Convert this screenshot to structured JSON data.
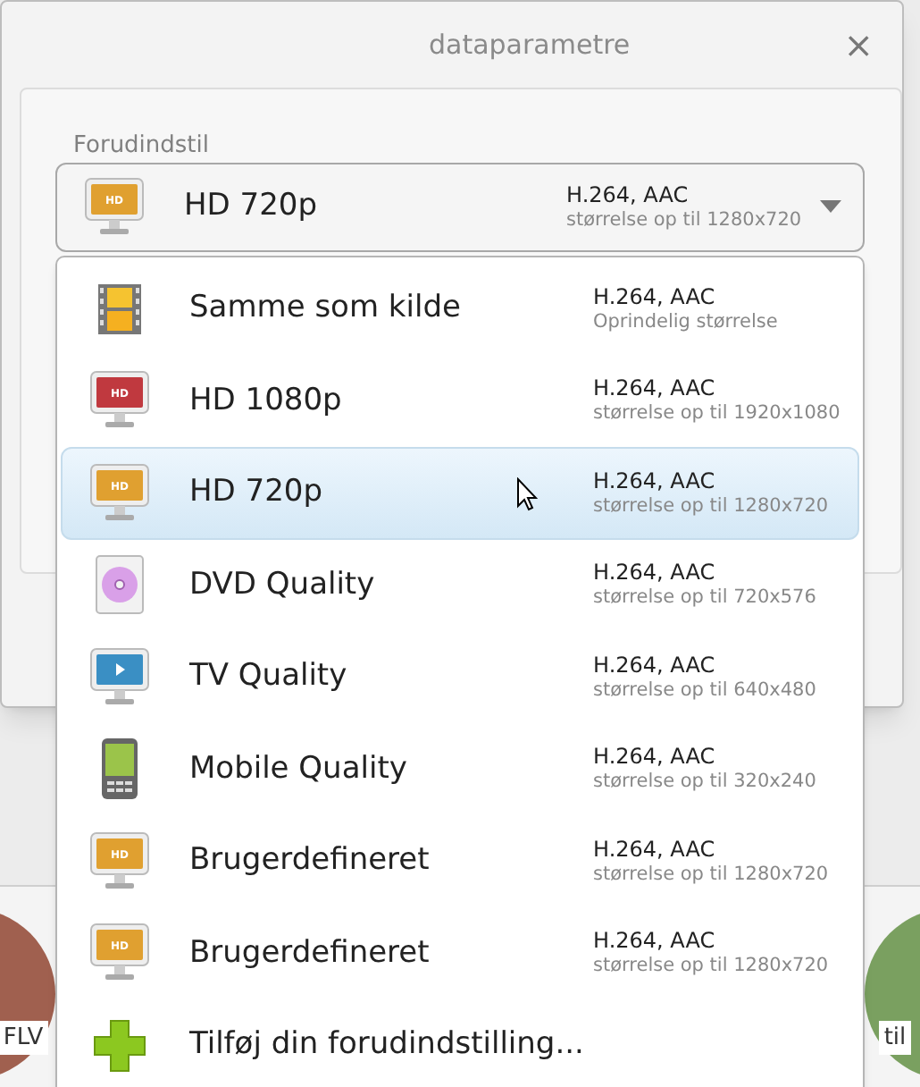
{
  "dialog": {
    "title": "dataparametre",
    "close": "×"
  },
  "preset_label": "Forudindstil",
  "dropdown": {
    "kind": "monitor",
    "color": "#e0a030",
    "badge": "HD",
    "name": "HD 720p",
    "codec": "H.264, AAC",
    "detail": "størrelse op til 1280x720",
    "expanded": true
  },
  "options": [
    {
      "kind": "film",
      "name": "Samme som kilde",
      "codec": "H.264, AAC",
      "detail": "Oprindelig størrelse",
      "selected": false
    },
    {
      "kind": "monitor",
      "color": "#c0393f",
      "badge": "HD",
      "name": "HD 1080p",
      "codec": "H.264, AAC",
      "detail": "størrelse op til 1920x1080",
      "selected": false
    },
    {
      "kind": "monitor",
      "color": "#e0a030",
      "badge": "HD",
      "name": "HD 720p",
      "codec": "H.264, AAC",
      "detail": "størrelse op til 1280x720",
      "selected": true
    },
    {
      "kind": "dvd",
      "name": "DVD Quality",
      "codec": "H.264, AAC",
      "detail": "størrelse op til 720x576",
      "selected": false
    },
    {
      "kind": "tv",
      "name": "TV Quality",
      "codec": "H.264, AAC",
      "detail": "størrelse op til 640x480",
      "selected": false
    },
    {
      "kind": "mobile",
      "name": "Mobile Quality",
      "codec": "H.264, AAC",
      "detail": "størrelse op til 320x240",
      "selected": false
    },
    {
      "kind": "monitor",
      "color": "#e0a030",
      "badge": "HD",
      "name": "Brugerdefineret",
      "codec": "H.264, AAC",
      "detail": "størrelse op til 1280x720",
      "selected": false
    },
    {
      "kind": "monitor",
      "color": "#e0a030",
      "badge": "HD",
      "name": "Brugerdefineret",
      "codec": "H.264, AAC",
      "detail": "størrelse op til 1280x720",
      "selected": false
    },
    {
      "kind": "add",
      "name": "Tilføj din forudindstilling...",
      "selected": false
    }
  ],
  "background_buttons": [
    {
      "label": "FLV",
      "color": "#a0604f"
    },
    {
      "label": "til",
      "color": "#7aa060"
    }
  ]
}
